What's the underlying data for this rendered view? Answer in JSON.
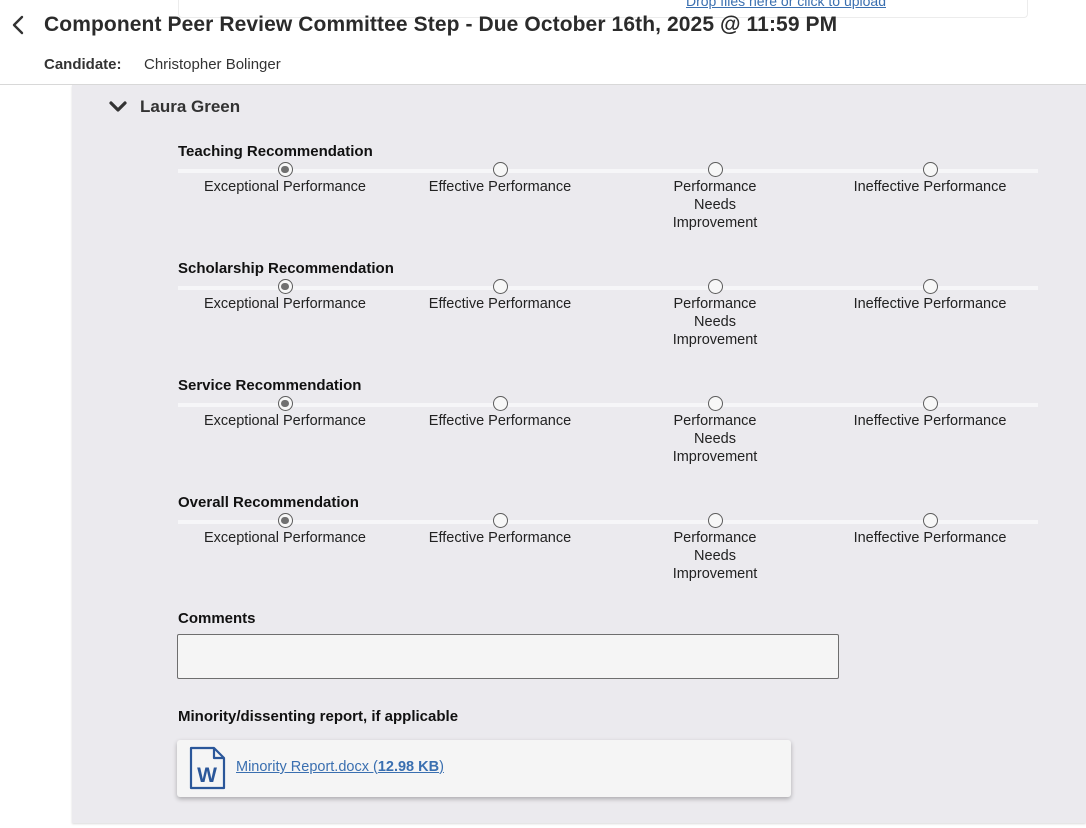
{
  "header": {
    "upload_hint": "Drop files here or click to upload",
    "title": "Component Peer Review Committee Step - Due October 16th, 2025 @ 11:59 PM",
    "candidate_label": "Candidate:",
    "candidate_name": "Christopher Bolinger"
  },
  "reviewer": {
    "name": "Laura Green",
    "expanded": true
  },
  "recommendations": [
    {
      "title": "Teaching Recommendation",
      "selected": "Exceptional Performance",
      "options": [
        {
          "label": "Exceptional Performance",
          "checked": true
        },
        {
          "label": "Effective Performance",
          "checked": false
        },
        {
          "label": "Performance Needs Improvement",
          "checked": false
        },
        {
          "label": "Ineffective Performance",
          "checked": false
        }
      ]
    },
    {
      "title": "Scholarship Recommendation",
      "selected": "Exceptional Performance",
      "options": [
        {
          "label": "Exceptional Performance",
          "checked": true
        },
        {
          "label": "Effective Performance",
          "checked": false
        },
        {
          "label": "Performance Needs Improvement",
          "checked": false
        },
        {
          "label": "Ineffective Performance",
          "checked": false
        }
      ]
    },
    {
      "title": "Service Recommendation",
      "selected": "Exceptional Performance",
      "options": [
        {
          "label": "Exceptional Performance",
          "checked": true
        },
        {
          "label": "Effective Performance",
          "checked": false
        },
        {
          "label": "Performance Needs Improvement",
          "checked": false
        },
        {
          "label": "Ineffective Performance",
          "checked": false
        }
      ]
    },
    {
      "title": "Overall Recommendation",
      "selected": "Exceptional Performance",
      "options": [
        {
          "label": "Exceptional Performance",
          "checked": true
        },
        {
          "label": "Effective Performance",
          "checked": false
        },
        {
          "label": "Performance Needs Improvement",
          "checked": false
        },
        {
          "label": "Ineffective Performance",
          "checked": false
        }
      ]
    }
  ],
  "comments": {
    "label": "Comments",
    "value": ""
  },
  "minority_report": {
    "label": "Minority/dissenting report, if applicable",
    "file_name": "Minority Report.docx",
    "file_size": "12.98 KB",
    "icon": "word-document-icon",
    "icon_letter": "W"
  },
  "colors": {
    "panel_background": "#ebeaee",
    "link": "#3a6fb0",
    "word_blue": "#2b579a"
  }
}
